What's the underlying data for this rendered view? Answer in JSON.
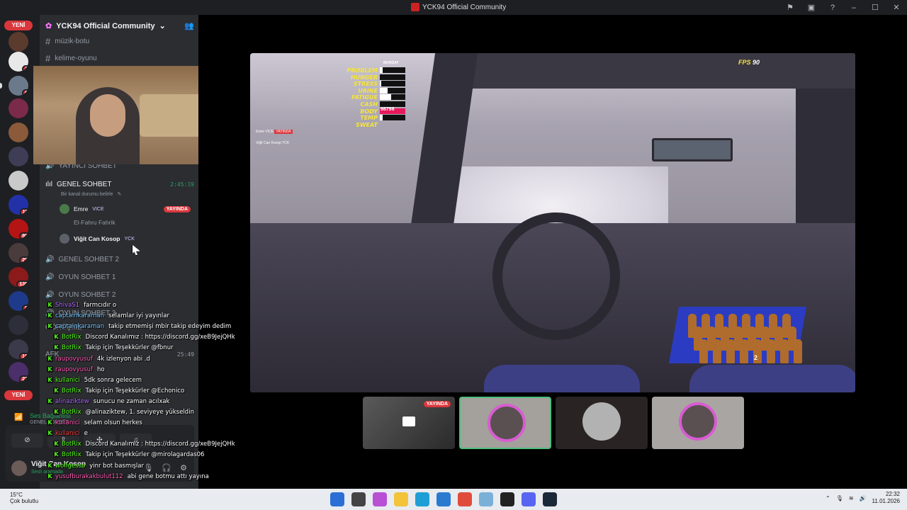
{
  "window": {
    "title": "YCK94 Official Community"
  },
  "guild": {
    "name": "YCK94 Official Community"
  },
  "text_channels": [
    {
      "name": "müzik-botu"
    },
    {
      "name": "kelime-oyunu"
    }
  ],
  "voice": {
    "yayinci": "YAYINCI SOHBET",
    "genel": "GENEL SOHBET",
    "genel_timer": "2:45:19",
    "genel_status": "Bir kanal durumu belirle",
    "users": [
      {
        "name": "Emre",
        "tag": "VICE",
        "live": "YAYINDA"
      },
      {
        "name": "El-Fahru Fahrik"
      },
      {
        "name": "Viğit Can Kosop",
        "tag": "YCK"
      }
    ],
    "genel2": "GENEL SOHBET 2",
    "oyun1": "OYUN SOHBET 1",
    "oyun2": "OYUN SOHBET 2",
    "oyun3": "OYUN SOHBET 3",
    "gorusme": "GÖRÜŞME",
    "afk": "AFK",
    "afk_timer": "25:49"
  },
  "servers": {
    "new_label": "YENİ",
    "badges": [
      "2",
      "6",
      "11",
      "98",
      "29",
      "139",
      "8",
      "10",
      "22"
    ]
  },
  "voice_connection": {
    "title": "Ses Bağlantısı",
    "channel": "GENEL SOHBET"
  },
  "user": {
    "name": "Viğit Can Kosop",
    "status": "Sesli aramada"
  },
  "game": {
    "day": "MONDAY",
    "stats": [
      {
        "label": "PROBLEM",
        "value": 0.1
      },
      {
        "label": "HUNGER",
        "value": 0.0
      },
      {
        "label": "STRESS",
        "value": 0.05
      },
      {
        "label": "URINE",
        "value": 0.3
      },
      {
        "label": "FATIGUE",
        "value": 0.45
      },
      {
        "label": "CASH",
        "value": 0.0
      },
      {
        "label": "BODY TEMP",
        "value": 0.1
      },
      {
        "label": "SWEAT",
        "value": 0.1
      }
    ],
    "cash": "98798",
    "fps_label": "FPS",
    "fps_value": "90",
    "crate_count": "2",
    "ingame_users": [
      "Emre",
      "VICE",
      "YAYINDA",
      "Viğit Can Kosop",
      "YCK"
    ]
  },
  "thumbs": {
    "live": "YAYINDA"
  },
  "chat": [
    {
      "user": "ShivaS1",
      "msg": "farmcıdır o",
      "color": "#b06bff"
    },
    {
      "user": "captainkaraman",
      "msg": "selamlar iyi yayınlar",
      "color": "#79c7ff"
    },
    {
      "user": "captainkaraman",
      "msg": "takip etmemişi mbir takip edeyim dedim",
      "color": "#79c7ff"
    },
    {
      "user": "BotRix",
      "msg": "Discord Kanalımız : https://discord.gg/xeB9JejQHk",
      "color": "#53fc18"
    },
    {
      "user": "BotRix",
      "msg": "Takip için Teşekkürler @fbnur",
      "color": "#53fc18"
    },
    {
      "user": "raupovyusuf",
      "msg": "4k izlenyon abi .d",
      "color": "#ff5ab4"
    },
    {
      "user": "raupovyusuf",
      "msg": "ho",
      "color": "#ff5ab4"
    },
    {
      "user": "kullanici",
      "msg": "5dk sonra gelecem",
      "color": "#53fc18"
    },
    {
      "user": "BotRix",
      "msg": "Takip için Teşekkürler @Echonico",
      "color": "#53fc18"
    },
    {
      "user": "alinaziktew",
      "msg": "sunucu ne zaman acılxak",
      "color": "#b06bff"
    },
    {
      "user": "BotRix",
      "msg": "@alinaziktew, 1. seviyeye yükseldin",
      "color": "#53fc18"
    },
    {
      "user": "kullanici",
      "msg": "selam olsun herkes",
      "color": "#ff5ab4"
    },
    {
      "user": "kullanici",
      "msg": "e",
      "color": "#ff4040"
    },
    {
      "user": "BotRix",
      "msg": "Discord Kanalımız : https://discord.gg/xeB9JejQHk",
      "color": "#53fc18"
    },
    {
      "user": "BotRix",
      "msg": "Takip için Teşekkürler @mirolagardas06",
      "color": "#53fc18"
    },
    {
      "user": "wolfgesso",
      "msg": "yinr bot basmışlar",
      "color": "#53fc18"
    },
    {
      "user": "yusufburakakbulut112",
      "msg": "abi gene botmu attı yayına",
      "color": "#ff5ab4"
    }
  ],
  "taskbar": {
    "temp": "15°C",
    "weather": "Çok bulutlu",
    "time": "22:32",
    "date": "11.01.2026"
  }
}
